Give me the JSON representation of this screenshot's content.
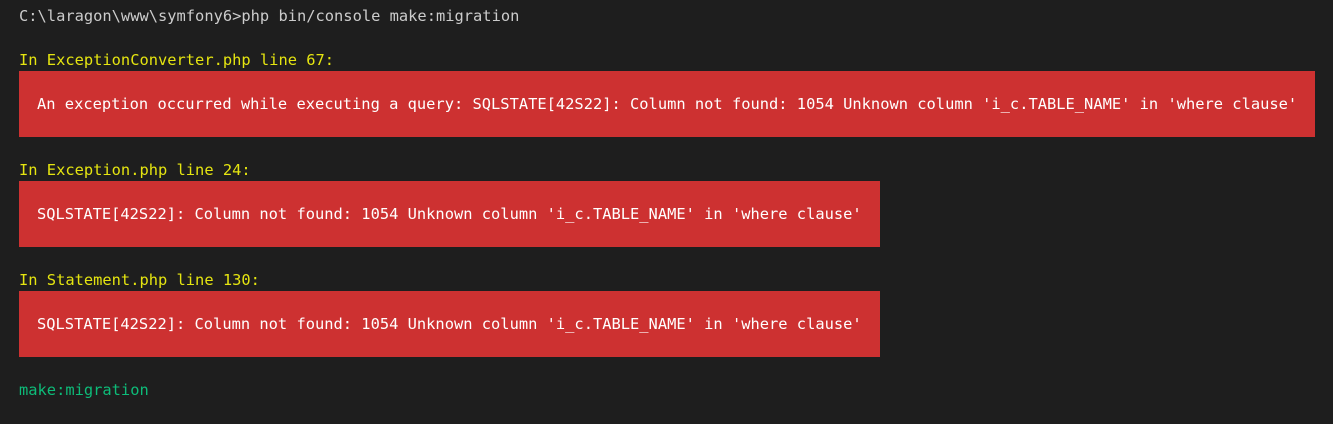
{
  "terminal": {
    "prompt": "C:\\laragon\\www\\symfony6>php bin/console make:migration",
    "errors": [
      {
        "heading": "In ExceptionConverter.php line 67:",
        "message": "An exception occurred while executing a query: SQLSTATE[42S22]: Column not found: 1054 Unknown column 'i_c.TABLE_NAME' in 'where clause'"
      },
      {
        "heading": "In Exception.php line 24:",
        "message": "SQLSTATE[42S22]: Column not found: 1054 Unknown column 'i_c.TABLE_NAME' in 'where clause'"
      },
      {
        "heading": "In Statement.php line 130:",
        "message": "SQLSTATE[42S22]: Column not found: 1054 Unknown column 'i_c.TABLE_NAME' in 'where clause'"
      }
    ],
    "footer_command": "make:migration"
  },
  "colors": {
    "background": "#1e1e1e",
    "text": "#cccccc",
    "heading": "#e5e510",
    "error_bg": "#cd3131",
    "error_text": "#ffffff",
    "command": "#0dbc79"
  }
}
